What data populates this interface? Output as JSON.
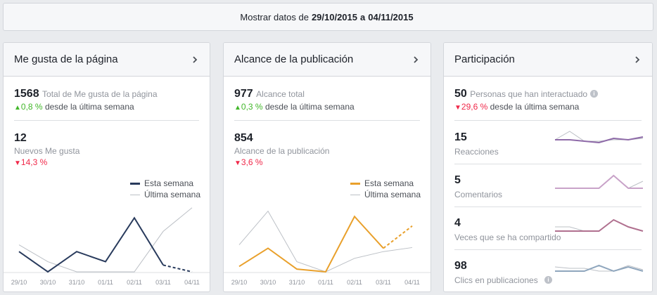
{
  "date_range": {
    "prefix": "Mostrar datos de",
    "start": "29/10/2015",
    "connector": "a",
    "end": "04/11/2015"
  },
  "colors": {
    "this_week_likes": "#283a5c",
    "this_week_reach": "#e9a02b",
    "last_week": "#bcc0c6",
    "part_purple": "#8e6aa8",
    "part_pink": "#c8a2c8",
    "part_mauve": "#b0708f",
    "part_blue": "#8fa6bd"
  },
  "icons": {
    "chevron": "chevron-right-icon",
    "up": "triangle-up-icon",
    "down": "triangle-down-icon",
    "info": "info-icon"
  },
  "likes_card": {
    "title": "Me gusta de la página",
    "total_value": "1568",
    "total_label": "Total de Me gusta de la página",
    "total_change": "0,8 %",
    "total_change_suffix": "desde la última semana",
    "new_value": "12",
    "new_label": "Nuevos Me gusta",
    "new_change": "14,3 %"
  },
  "reach_card": {
    "title": "Alcance de la publicación",
    "total_value": "977",
    "total_label": "Alcance total",
    "total_change": "0,3 %",
    "total_change_suffix": "desde la última semana",
    "post_value": "854",
    "post_label": "Alcance de la publicación",
    "post_change": "3,6 %"
  },
  "engagement_card": {
    "title": "Participación",
    "total_value": "50",
    "total_label": "Personas que han interactuado",
    "total_change": "29,6 %",
    "total_change_suffix": "desde la última semana",
    "rows": [
      {
        "value": "15",
        "label": "Reacciones"
      },
      {
        "value": "5",
        "label": "Comentarios"
      },
      {
        "value": "4",
        "label": "Veces que se ha compartido"
      },
      {
        "value": "98",
        "label": "Clics en publicaciones"
      }
    ]
  },
  "legend": {
    "this_week": "Esta semana",
    "last_week": "Última semana"
  },
  "chart_data": [
    {
      "type": "line",
      "categories": [
        "29/10",
        "30/10",
        "31/10",
        "01/11",
        "02/11",
        "03/11",
        "04/11"
      ],
      "ylim": [
        0,
        10
      ],
      "series": [
        {
          "name": "Esta semana",
          "values": [
            3,
            0,
            3,
            1.5,
            8,
            1,
            0
          ]
        },
        {
          "name": "Última semana",
          "values": [
            4,
            1.5,
            0,
            0,
            0,
            6,
            9.5
          ]
        }
      ]
    },
    {
      "type": "line",
      "categories": [
        "29/10",
        "30/10",
        "31/10",
        "01/11",
        "02/11",
        "03/11",
        "04/11"
      ],
      "ylim": [
        0,
        10
      ],
      "series": [
        {
          "name": "Esta semana",
          "values": [
            0.8,
            3.5,
            0.4,
            0,
            8.2,
            3.5,
            6.8
          ]
        },
        {
          "name": "Última semana",
          "values": [
            4,
            9,
            1.5,
            0,
            2,
            3,
            3.6
          ]
        }
      ]
    },
    {
      "type": "line",
      "ylim": [
        0,
        10
      ],
      "series": [
        {
          "values": [
            4,
            4,
            3,
            2,
            5,
            4,
            6
          ]
        },
        {
          "values": [
            4,
            10,
            3,
            3,
            4,
            4,
            5
          ]
        }
      ]
    },
    {
      "type": "line",
      "ylim": [
        0,
        10
      ],
      "series": [
        {
          "values": [
            0,
            0,
            0,
            0,
            9,
            0,
            0
          ]
        },
        {
          "values": [
            0,
            0,
            0,
            0,
            9,
            0,
            5
          ]
        }
      ]
    },
    {
      "type": "line",
      "ylim": [
        0,
        10
      ],
      "series": [
        {
          "values": [
            0,
            0,
            0,
            0,
            8,
            3,
            0
          ]
        },
        {
          "values": [
            3,
            3,
            0,
            0,
            8,
            3,
            0
          ]
        }
      ]
    },
    {
      "type": "line",
      "ylim": [
        0,
        10
      ],
      "series": [
        {
          "values": [
            2,
            2,
            2,
            6,
            2,
            5,
            2
          ]
        },
        {
          "values": [
            5,
            4,
            4,
            2,
            2,
            6,
            3
          ]
        }
      ]
    }
  ]
}
